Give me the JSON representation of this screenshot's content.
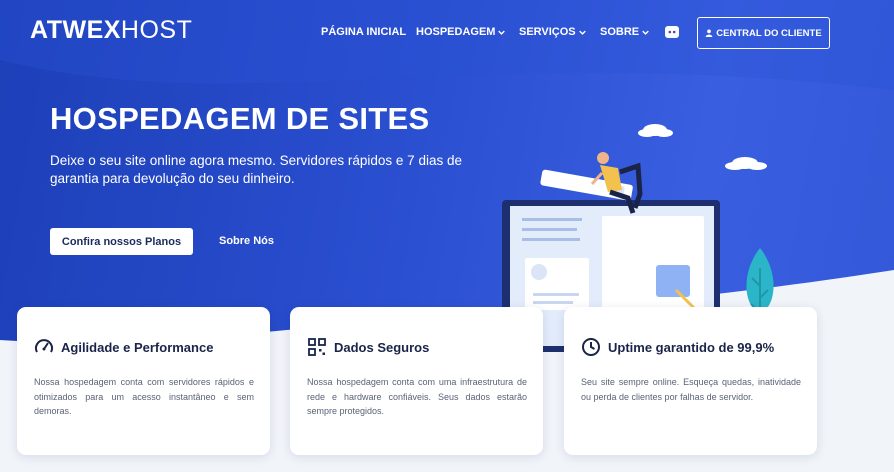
{
  "brand": {
    "logo_bold": "ATWEX",
    "logo_light": "HOST"
  },
  "nav": {
    "items": [
      {
        "label": "PÁGINA INICIAL",
        "dropdown": false
      },
      {
        "label": "HOSPEDAGEM",
        "dropdown": true
      },
      {
        "label": "SERVIÇOS",
        "dropdown": true
      },
      {
        "label": "SOBRE",
        "dropdown": true
      }
    ],
    "discord_icon": "discord-icon",
    "client_button": "CENTRAL DO CLIENTE"
  },
  "hero": {
    "title": "HOSPEDAGEM DE SITES",
    "subtitle": "Deixe o seu site online agora mesmo. Servidores rápidos e 7 dias de garantia para devolução do seu dinheiro.",
    "primary_button": "Confira nossos Planos",
    "secondary_link": "Sobre Nós"
  },
  "features": [
    {
      "icon": "speedometer-icon",
      "title": "Agilidade e Performance",
      "text": "Nossa hospedagem conta com servidores rápidos e otimizados para um acesso instantâneo e sem demoras."
    },
    {
      "icon": "grid-icon",
      "title": "Dados Seguros",
      "text": "Nossa hospedagem conta com uma infraestrutura de rede e hardware confiáveis. Seus dados estarão sempre protegidos."
    },
    {
      "icon": "clock-icon",
      "title": "Uptime garantido de 99,9%",
      "text": "Seu site sempre online. Esqueça quedas, inatividade ou perda de clientes por falhas de servidor."
    }
  ],
  "colors": {
    "hero_blue": "#2a4fd0",
    "text_dark": "#1a2448",
    "card_text": "#5a6275",
    "accent_yellow": "#f2c14e",
    "accent_teal": "#2bb5c8"
  }
}
